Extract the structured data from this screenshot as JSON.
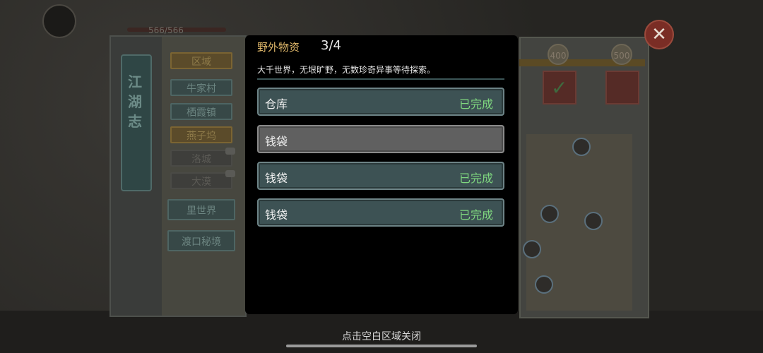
{
  "hud": {
    "hp_text": "566/566"
  },
  "journal": {
    "title": "江湖志",
    "header": "区域",
    "regions": [
      {
        "label": "牛家村",
        "state": "normal"
      },
      {
        "label": "栖霞镇",
        "state": "normal"
      },
      {
        "label": "燕子坞",
        "state": "active"
      },
      {
        "label": "洛城",
        "state": "locked"
      },
      {
        "label": "大漠",
        "state": "locked"
      }
    ],
    "special": [
      "里世界",
      "渡口秘境"
    ]
  },
  "progress": {
    "milestones": [
      "400",
      "500"
    ]
  },
  "modal": {
    "title": "野外物资",
    "count": "3/4",
    "description": "大千世界，无垠旷野，无数珍奇异事等待探索。",
    "items": [
      {
        "label": "仓库",
        "status": "已完成",
        "done": true
      },
      {
        "label": "钱袋",
        "status": "",
        "done": false
      },
      {
        "label": "钱袋",
        "status": "已完成",
        "done": true
      },
      {
        "label": "钱袋",
        "status": "已完成",
        "done": true
      }
    ]
  },
  "hint": "点击空白区域关闭",
  "icons": {
    "close": "close-icon",
    "check": "checkmark-icon"
  }
}
